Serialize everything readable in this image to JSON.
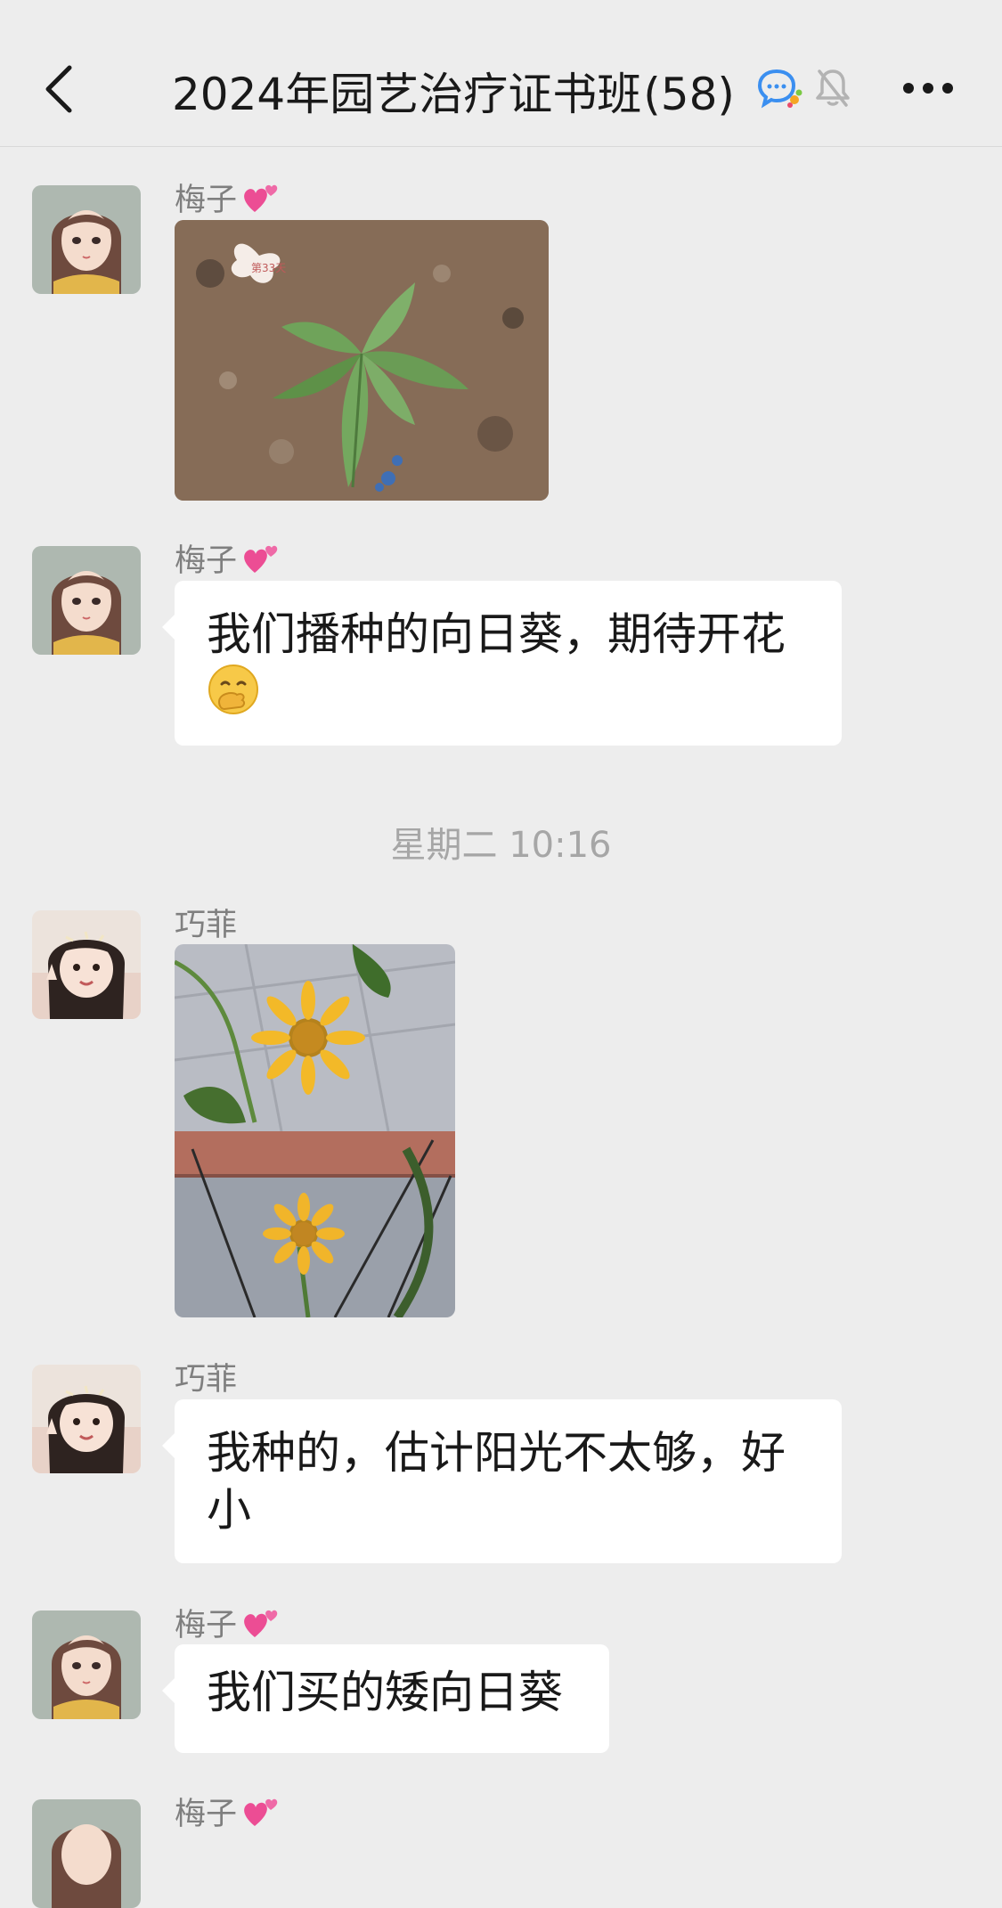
{
  "header": {
    "title": "2024年园艺治疗证书班",
    "member_count": "(58)",
    "back_icon": "chevron-left-icon",
    "chat_icon": "group-chat-icon",
    "mute_icon": "bell-muted-icon",
    "more_icon": "more-dots-icon"
  },
  "timestamp": "星期二 10:16",
  "messages": [
    {
      "sender": "梅子",
      "type": "image",
      "image_label": "第33天",
      "avatar": "avatar-meizi"
    },
    {
      "sender": "梅子",
      "type": "text",
      "line1": "我们播种的向日葵，期待开花",
      "emoji": "face-with-hand-over-mouth-emoji",
      "avatar": "avatar-meizi"
    },
    {
      "sender": "巧菲",
      "type": "image",
      "avatar": "avatar-qiaofei"
    },
    {
      "sender": "巧菲",
      "type": "text",
      "line1": "我种的，估计阳光不太够，好",
      "line2": "小",
      "avatar": "avatar-qiaofei"
    },
    {
      "sender": "梅子",
      "type": "text",
      "line1": "我们买的矮向日葵",
      "avatar": "avatar-meizi"
    },
    {
      "sender": "梅子",
      "type": "partial",
      "avatar": "avatar-meizi"
    }
  ],
  "colors": {
    "background": "#ededed",
    "bubble": "#ffffff",
    "sender_text": "#7f7f7f",
    "message_text": "#191919",
    "timestamp_text": "#a6a6a6"
  }
}
